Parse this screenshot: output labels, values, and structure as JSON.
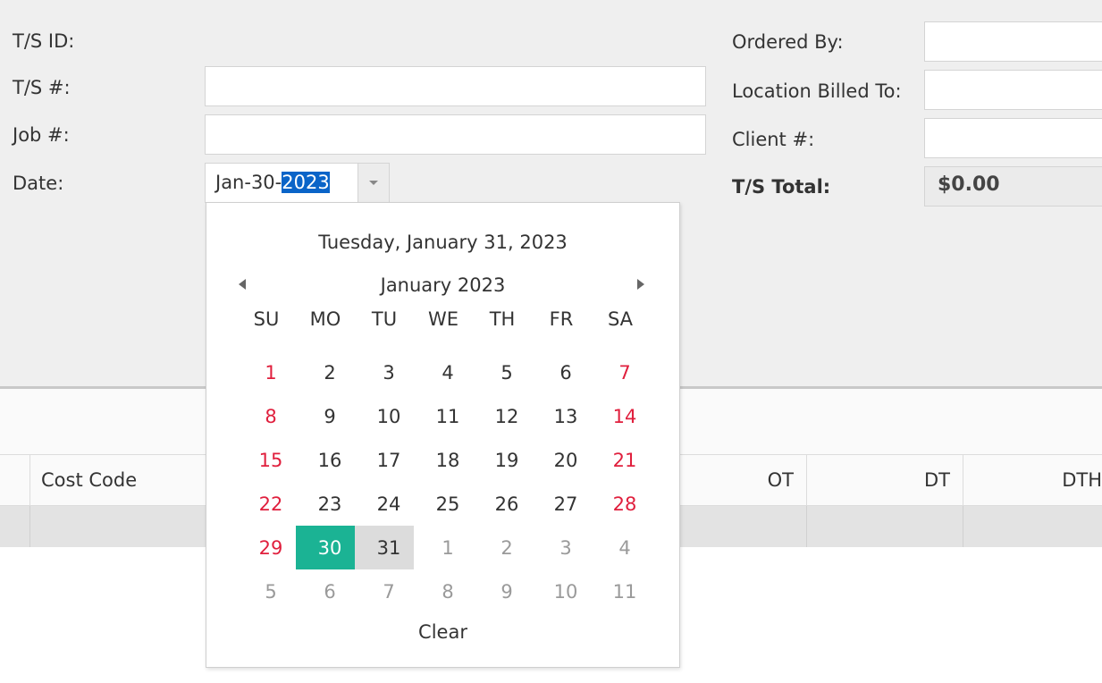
{
  "form": {
    "ts_id_label": "T/S ID:",
    "ts_num_label": "T/S #:",
    "job_label": "Job #:",
    "date_label": "Date:",
    "ordered_by_label": "Ordered By:",
    "location_billed_label": "Location Billed To:",
    "client_label": "Client #:",
    "total_label": "T/S Total:",
    "total_value": "$0.00",
    "ts_num_value": "",
    "job_value": "",
    "ordered_by_value": "",
    "location_billed_value": "",
    "client_value": ""
  },
  "date_edit": {
    "prefix": "Jan-30-",
    "selected_part": "2023"
  },
  "calendar": {
    "today_text": "Tuesday, January 31, 2023",
    "month_title": "January 2023",
    "day_headers": [
      "SU",
      "MO",
      "TU",
      "WE",
      "TH",
      "FR",
      "SA"
    ],
    "weeks": [
      [
        "1",
        "2",
        "3",
        "4",
        "5",
        "6",
        "7"
      ],
      [
        "8",
        "9",
        "10",
        "11",
        "12",
        "13",
        "14"
      ],
      [
        "15",
        "16",
        "17",
        "18",
        "19",
        "20",
        "21"
      ],
      [
        "22",
        "23",
        "24",
        "25",
        "26",
        "27",
        "28"
      ],
      [
        "29",
        "30",
        "31",
        "1",
        "2",
        "3",
        "4"
      ],
      [
        "5",
        "6",
        "7",
        "8",
        "9",
        "10",
        "11"
      ]
    ],
    "selected_day": "30",
    "today_day": "31",
    "clear_label": "Clear",
    "colors": {
      "selected_bg": "#1bb394",
      "weekend": "#e01f3d",
      "outside": "#9a9a9a"
    }
  },
  "grid": {
    "columns": [
      "Cost Code",
      "OT",
      "DT",
      "DTH"
    ]
  }
}
